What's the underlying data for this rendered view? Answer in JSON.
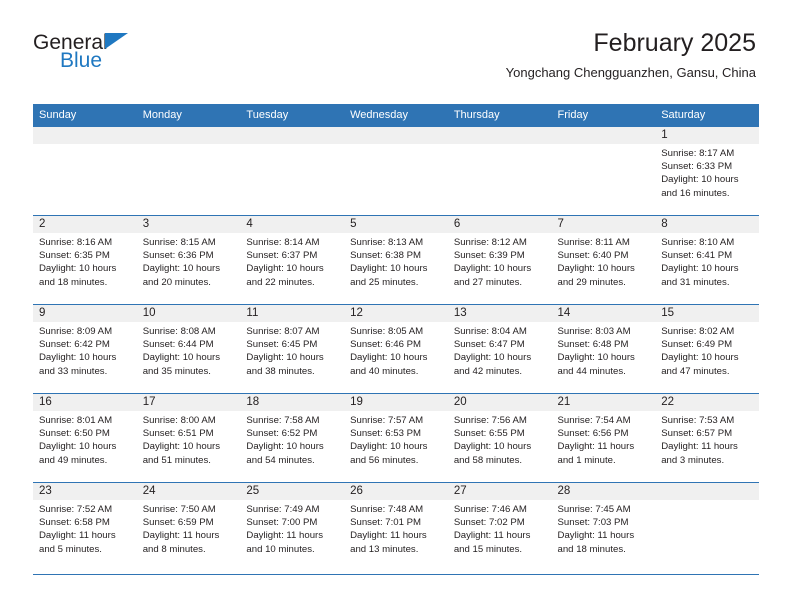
{
  "brand": {
    "name_part1": "General",
    "name_part2": "Blue"
  },
  "header": {
    "title": "February 2025",
    "subtitle": "Yongchang Chengguanzhen, Gansu, China"
  },
  "colors": {
    "header_blue": "#2f74b4",
    "logo_blue": "#1f78c1",
    "daynum_band": "#f0f0f0",
    "text": "#231f20"
  },
  "weekdays": [
    "Sunday",
    "Monday",
    "Tuesday",
    "Wednesday",
    "Thursday",
    "Friday",
    "Saturday"
  ],
  "weeks": [
    [
      {
        "day": "",
        "blank": true
      },
      {
        "day": "",
        "blank": true
      },
      {
        "day": "",
        "blank": true
      },
      {
        "day": "",
        "blank": true
      },
      {
        "day": "",
        "blank": true
      },
      {
        "day": "",
        "blank": true
      },
      {
        "day": "1",
        "sunrise": "Sunrise: 8:17 AM",
        "sunset": "Sunset: 6:33 PM",
        "daylight1": "Daylight: 10 hours",
        "daylight2": "and 16 minutes."
      }
    ],
    [
      {
        "day": "2",
        "sunrise": "Sunrise: 8:16 AM",
        "sunset": "Sunset: 6:35 PM",
        "daylight1": "Daylight: 10 hours",
        "daylight2": "and 18 minutes."
      },
      {
        "day": "3",
        "sunrise": "Sunrise: 8:15 AM",
        "sunset": "Sunset: 6:36 PM",
        "daylight1": "Daylight: 10 hours",
        "daylight2": "and 20 minutes."
      },
      {
        "day": "4",
        "sunrise": "Sunrise: 8:14 AM",
        "sunset": "Sunset: 6:37 PM",
        "daylight1": "Daylight: 10 hours",
        "daylight2": "and 22 minutes."
      },
      {
        "day": "5",
        "sunrise": "Sunrise: 8:13 AM",
        "sunset": "Sunset: 6:38 PM",
        "daylight1": "Daylight: 10 hours",
        "daylight2": "and 25 minutes."
      },
      {
        "day": "6",
        "sunrise": "Sunrise: 8:12 AM",
        "sunset": "Sunset: 6:39 PM",
        "daylight1": "Daylight: 10 hours",
        "daylight2": "and 27 minutes."
      },
      {
        "day": "7",
        "sunrise": "Sunrise: 8:11 AM",
        "sunset": "Sunset: 6:40 PM",
        "daylight1": "Daylight: 10 hours",
        "daylight2": "and 29 minutes."
      },
      {
        "day": "8",
        "sunrise": "Sunrise: 8:10 AM",
        "sunset": "Sunset: 6:41 PM",
        "daylight1": "Daylight: 10 hours",
        "daylight2": "and 31 minutes."
      }
    ],
    [
      {
        "day": "9",
        "sunrise": "Sunrise: 8:09 AM",
        "sunset": "Sunset: 6:42 PM",
        "daylight1": "Daylight: 10 hours",
        "daylight2": "and 33 minutes."
      },
      {
        "day": "10",
        "sunrise": "Sunrise: 8:08 AM",
        "sunset": "Sunset: 6:44 PM",
        "daylight1": "Daylight: 10 hours",
        "daylight2": "and 35 minutes."
      },
      {
        "day": "11",
        "sunrise": "Sunrise: 8:07 AM",
        "sunset": "Sunset: 6:45 PM",
        "daylight1": "Daylight: 10 hours",
        "daylight2": "and 38 minutes."
      },
      {
        "day": "12",
        "sunrise": "Sunrise: 8:05 AM",
        "sunset": "Sunset: 6:46 PM",
        "daylight1": "Daylight: 10 hours",
        "daylight2": "and 40 minutes."
      },
      {
        "day": "13",
        "sunrise": "Sunrise: 8:04 AM",
        "sunset": "Sunset: 6:47 PM",
        "daylight1": "Daylight: 10 hours",
        "daylight2": "and 42 minutes."
      },
      {
        "day": "14",
        "sunrise": "Sunrise: 8:03 AM",
        "sunset": "Sunset: 6:48 PM",
        "daylight1": "Daylight: 10 hours",
        "daylight2": "and 44 minutes."
      },
      {
        "day": "15",
        "sunrise": "Sunrise: 8:02 AM",
        "sunset": "Sunset: 6:49 PM",
        "daylight1": "Daylight: 10 hours",
        "daylight2": "and 47 minutes."
      }
    ],
    [
      {
        "day": "16",
        "sunrise": "Sunrise: 8:01 AM",
        "sunset": "Sunset: 6:50 PM",
        "daylight1": "Daylight: 10 hours",
        "daylight2": "and 49 minutes."
      },
      {
        "day": "17",
        "sunrise": "Sunrise: 8:00 AM",
        "sunset": "Sunset: 6:51 PM",
        "daylight1": "Daylight: 10 hours",
        "daylight2": "and 51 minutes."
      },
      {
        "day": "18",
        "sunrise": "Sunrise: 7:58 AM",
        "sunset": "Sunset: 6:52 PM",
        "daylight1": "Daylight: 10 hours",
        "daylight2": "and 54 minutes."
      },
      {
        "day": "19",
        "sunrise": "Sunrise: 7:57 AM",
        "sunset": "Sunset: 6:53 PM",
        "daylight1": "Daylight: 10 hours",
        "daylight2": "and 56 minutes."
      },
      {
        "day": "20",
        "sunrise": "Sunrise: 7:56 AM",
        "sunset": "Sunset: 6:55 PM",
        "daylight1": "Daylight: 10 hours",
        "daylight2": "and 58 minutes."
      },
      {
        "day": "21",
        "sunrise": "Sunrise: 7:54 AM",
        "sunset": "Sunset: 6:56 PM",
        "daylight1": "Daylight: 11 hours",
        "daylight2": "and 1 minute."
      },
      {
        "day": "22",
        "sunrise": "Sunrise: 7:53 AM",
        "sunset": "Sunset: 6:57 PM",
        "daylight1": "Daylight: 11 hours",
        "daylight2": "and 3 minutes."
      }
    ],
    [
      {
        "day": "23",
        "sunrise": "Sunrise: 7:52 AM",
        "sunset": "Sunset: 6:58 PM",
        "daylight1": "Daylight: 11 hours",
        "daylight2": "and 5 minutes."
      },
      {
        "day": "24",
        "sunrise": "Sunrise: 7:50 AM",
        "sunset": "Sunset: 6:59 PM",
        "daylight1": "Daylight: 11 hours",
        "daylight2": "and 8 minutes."
      },
      {
        "day": "25",
        "sunrise": "Sunrise: 7:49 AM",
        "sunset": "Sunset: 7:00 PM",
        "daylight1": "Daylight: 11 hours",
        "daylight2": "and 10 minutes."
      },
      {
        "day": "26",
        "sunrise": "Sunrise: 7:48 AM",
        "sunset": "Sunset: 7:01 PM",
        "daylight1": "Daylight: 11 hours",
        "daylight2": "and 13 minutes."
      },
      {
        "day": "27",
        "sunrise": "Sunrise: 7:46 AM",
        "sunset": "Sunset: 7:02 PM",
        "daylight1": "Daylight: 11 hours",
        "daylight2": "and 15 minutes."
      },
      {
        "day": "28",
        "sunrise": "Sunrise: 7:45 AM",
        "sunset": "Sunset: 7:03 PM",
        "daylight1": "Daylight: 11 hours",
        "daylight2": "and 18 minutes."
      },
      {
        "day": "",
        "blank": true
      }
    ]
  ]
}
